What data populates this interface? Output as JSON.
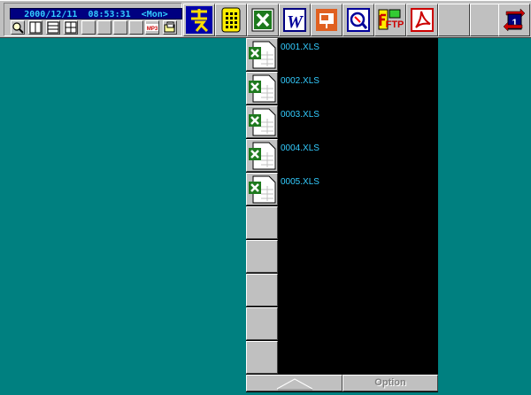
{
  "clock": {
    "text": "2000/12/11  08:53:31  <Mon>"
  },
  "toolbar": {
    "mini_icons": [
      "magnifier-icon",
      "layout-two-column-icon",
      "layout-rows-icon",
      "layout-grid-icon",
      "",
      "",
      "",
      "",
      "mp3-icon",
      "open-folder-icon"
    ],
    "mp3_label": "MP3",
    "apps": [
      "ichitaro-icon",
      "phone-dialer-icon",
      "excel-icon",
      "word-icon",
      "powerpoint-icon",
      "explorer-icon",
      "ftp-icon",
      "acrobat-icon",
      "",
      ""
    ],
    "ftp_label": "FTP",
    "desktop_number": "1"
  },
  "files": [
    {
      "name": "0001.XLS"
    },
    {
      "name": "0002.XLS"
    },
    {
      "name": "0003.XLS"
    },
    {
      "name": "0004.XLS"
    },
    {
      "name": "0005.XLS"
    }
  ],
  "empty_slots": 5,
  "bottom": {
    "option_label": "Option"
  },
  "colors": {
    "desktop": "#008080",
    "clock_bg": "#000080",
    "text_cyan": "#33ccff",
    "face": "#c0c0c0"
  }
}
